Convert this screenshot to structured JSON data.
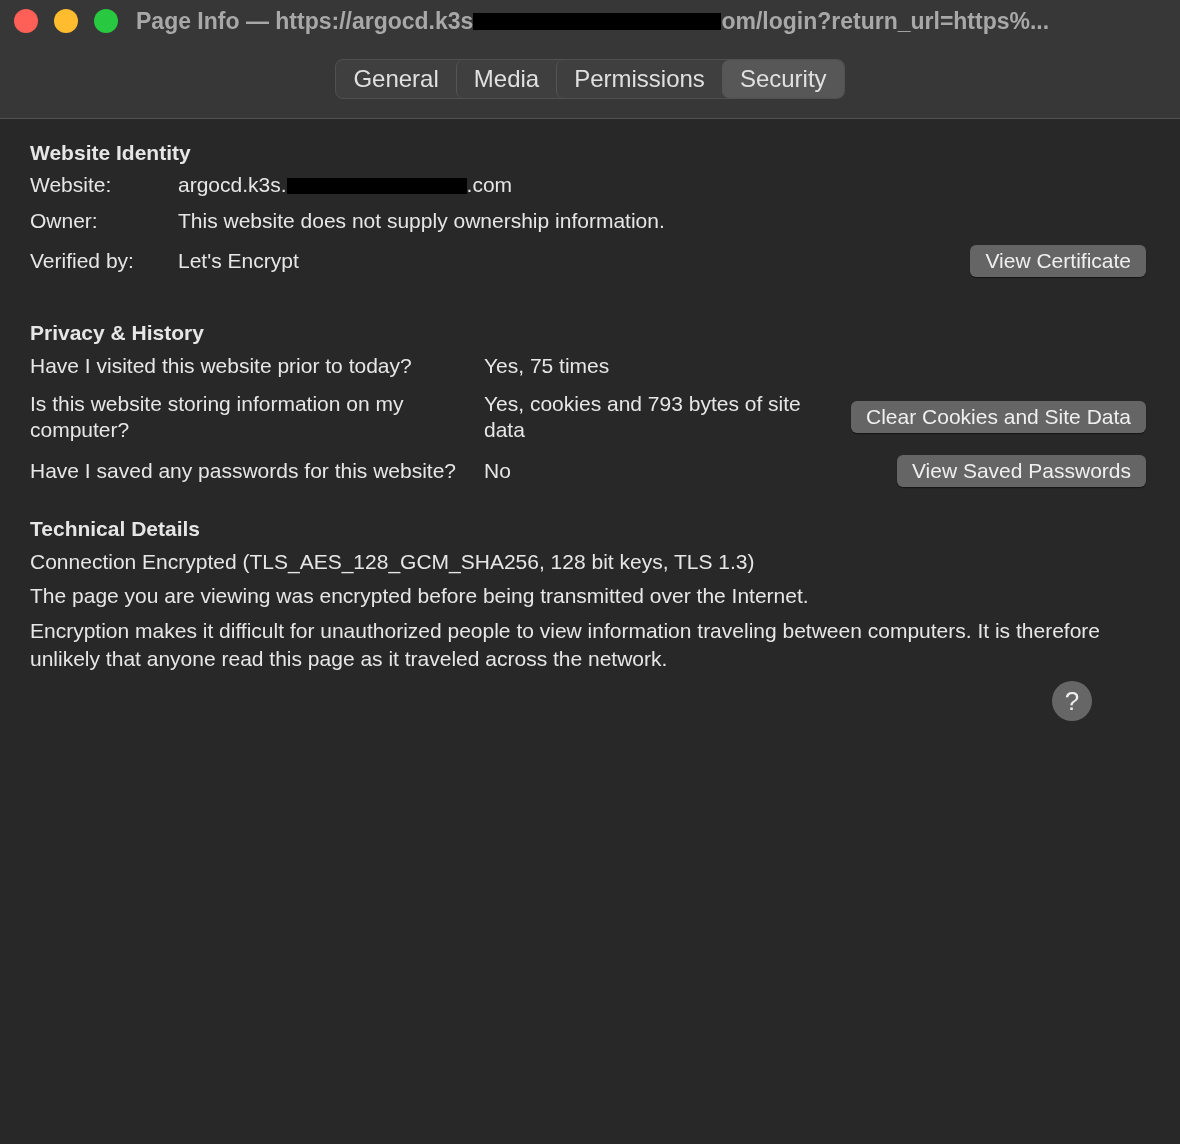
{
  "window": {
    "title_start": "Page Info — https://argocd.k3s",
    "title_end": "om/login?return_url=https%..."
  },
  "tabs": [
    {
      "label": "General",
      "selected": false
    },
    {
      "label": "Media",
      "selected": false
    },
    {
      "label": "Permissions",
      "selected": false
    },
    {
      "label": "Security",
      "selected": true
    }
  ],
  "identity": {
    "heading": "Website Identity",
    "website_label": "Website:",
    "website_start": "argocd.k3s.",
    "website_end": ".com",
    "owner_label": "Owner:",
    "owner": "This website does not supply ownership information.",
    "verified_label": "Verified by:",
    "verified": "Let's Encrypt",
    "button": "View Certificate"
  },
  "privacy": {
    "heading": "Privacy & History",
    "rows": [
      {
        "question": "Have I visited this website prior to today?",
        "answer": "Yes, 75 times"
      },
      {
        "question": "Is this website storing information on my computer?",
        "answer": "Yes, cookies and 793 bytes of site data",
        "button": "Clear Cookies and Site Data"
      },
      {
        "question": "Have I saved any passwords for this website?",
        "answer": "No",
        "button": "View Saved Passwords"
      }
    ]
  },
  "technical": {
    "heading": "Technical Details",
    "lines": [
      "Connection Encrypted (TLS_AES_128_GCM_SHA256, 128 bit keys, TLS 1.3)",
      "The page you are viewing was encrypted before being transmitted over the Internet.",
      "Encryption makes it difficult for unauthorized people to view information traveling between computers. It is therefore unlikely that anyone read this page as it traveled across the network."
    ]
  },
  "help": {
    "label": "?"
  }
}
